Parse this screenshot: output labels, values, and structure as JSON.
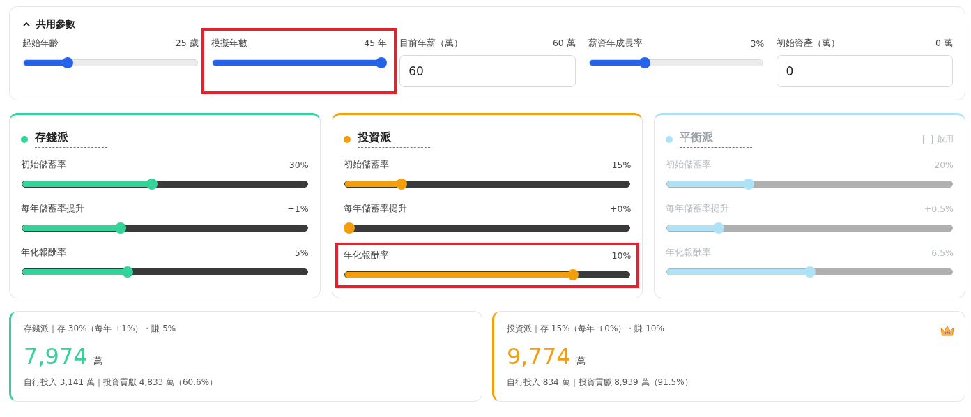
{
  "shared": {
    "title": "共用參數",
    "expanded": true,
    "params": [
      {
        "kind": "slider",
        "label": "起始年齡",
        "reading": "25 歲",
        "level": 0.24,
        "highlight": false
      },
      {
        "kind": "slider",
        "label": "模擬年數",
        "reading": "45 年",
        "level": 1.0,
        "highlight": true
      },
      {
        "kind": "input",
        "label": "目前年薪（萬）",
        "reading": "60 萬",
        "value": "60",
        "highlight": false
      },
      {
        "kind": "slider",
        "label": "薪資年成長率",
        "reading": "3%",
        "level": 0.31,
        "highlight": false
      },
      {
        "kind": "input",
        "label": "初始資產（萬）",
        "reading": "0 萬",
        "value": "0",
        "highlight": false
      }
    ]
  },
  "strategies": [
    {
      "name": "存錢派",
      "color": "#34d399",
      "enabled": true,
      "sliders": [
        {
          "label": "初始儲蓄率",
          "reading": "30%",
          "level": 0.455,
          "highlight": false
        },
        {
          "label": "每年儲蓄率提升",
          "reading": "+1%",
          "level": 0.34,
          "highlight": false
        },
        {
          "label": "年化報酬率",
          "reading": "5%",
          "level": 0.365,
          "highlight": false
        }
      ]
    },
    {
      "name": "投資派",
      "color": "#f59e0b",
      "enabled": true,
      "sliders": [
        {
          "label": "初始儲蓄率",
          "reading": "15%",
          "level": 0.19,
          "highlight": false
        },
        {
          "label": "每年儲蓄率提升",
          "reading": "+0%",
          "level": 0.0,
          "highlight": false
        },
        {
          "label": "年化報酬率",
          "reading": "10%",
          "level": 0.81,
          "highlight": true
        }
      ]
    },
    {
      "name": "平衡派",
      "color": "#aee3f7",
      "enabled": false,
      "toggle": "啟用",
      "sliders": [
        {
          "label": "初始儲蓄率",
          "reading": "20%",
          "level": 0.28,
          "highlight": false
        },
        {
          "label": "每年儲蓄率提升",
          "reading": "+0.5%",
          "level": 0.17,
          "highlight": false
        },
        {
          "label": "年化報酬率",
          "reading": "6.5%",
          "level": 0.5,
          "highlight": false
        }
      ]
    }
  ],
  "results": [
    {
      "summary": "存錢派｜存 30%（每年 +1%）・賺 5%",
      "total": "7,974",
      "unit": "萬",
      "detail": "自行投入 3,141 萬｜投資貢獻 4,833 萬（60.6%）",
      "color": "#34d399",
      "winner": false
    },
    {
      "summary": "投資派｜存 15%（每年 +0%）・賺 10%",
      "total": "9,774",
      "unit": "萬",
      "detail": "自行投入 834 萬｜投資貢獻 8,939 萬（91.5%）",
      "color": "#f59e0b",
      "winner": true
    }
  ]
}
